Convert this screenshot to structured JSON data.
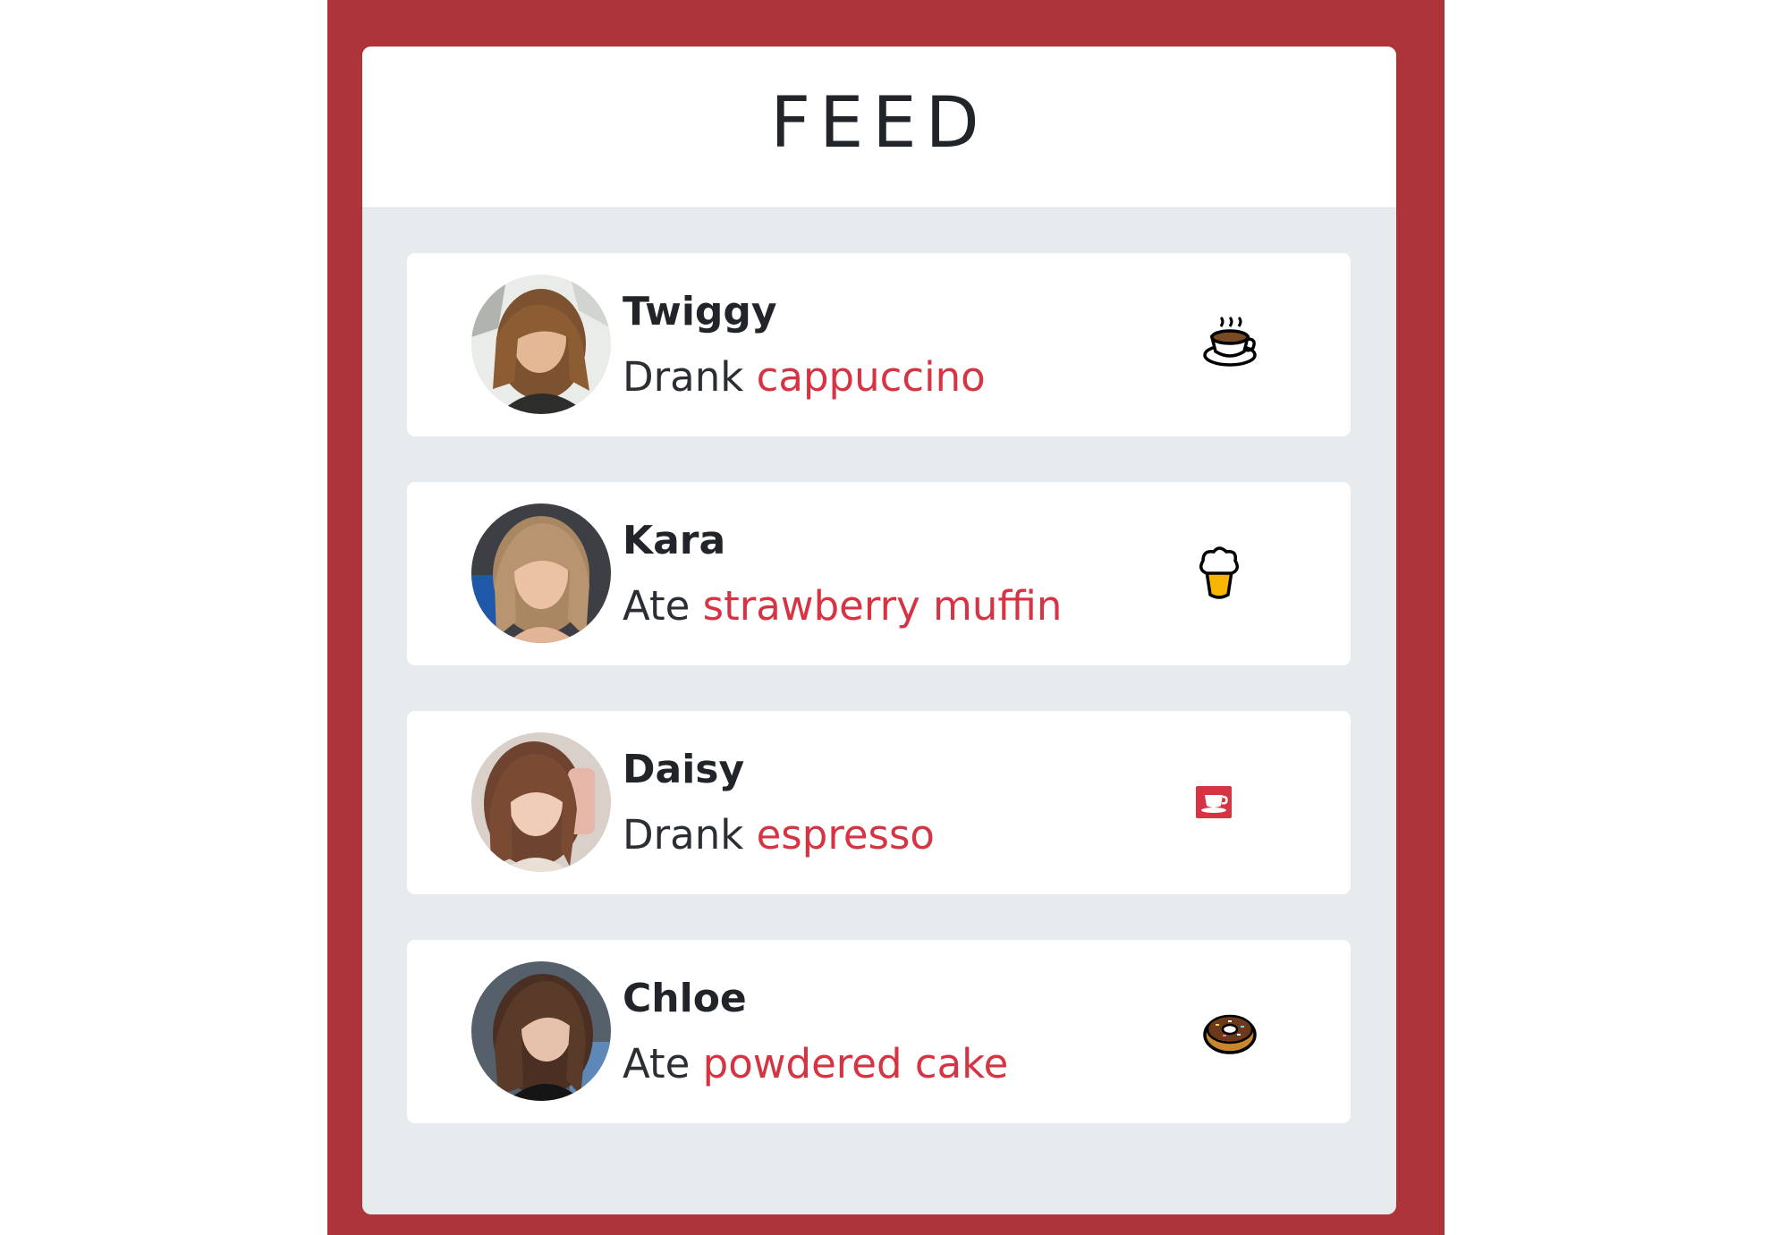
{
  "header": {
    "title": "FEED"
  },
  "feed": [
    {
      "name": "Twiggy",
      "verb": "Drank",
      "item": "cappuccino",
      "icon": "hot-beverage-icon"
    },
    {
      "name": "Kara",
      "verb": "Ate",
      "item": "strawberry muffin",
      "icon": "ice-cream-cone-icon"
    },
    {
      "name": "Daisy",
      "verb": "Drank",
      "item": "espresso",
      "icon": "coffee-cup-icon"
    },
    {
      "name": "Chloe",
      "verb": "Ate",
      "item": "powdered cake",
      "icon": "doughnut-icon"
    }
  ],
  "colors": {
    "frame": "#ad3438",
    "panel": "#e8ebee",
    "card": "#ffffff",
    "accent_text": "#d63343",
    "body_text": "#212529"
  }
}
